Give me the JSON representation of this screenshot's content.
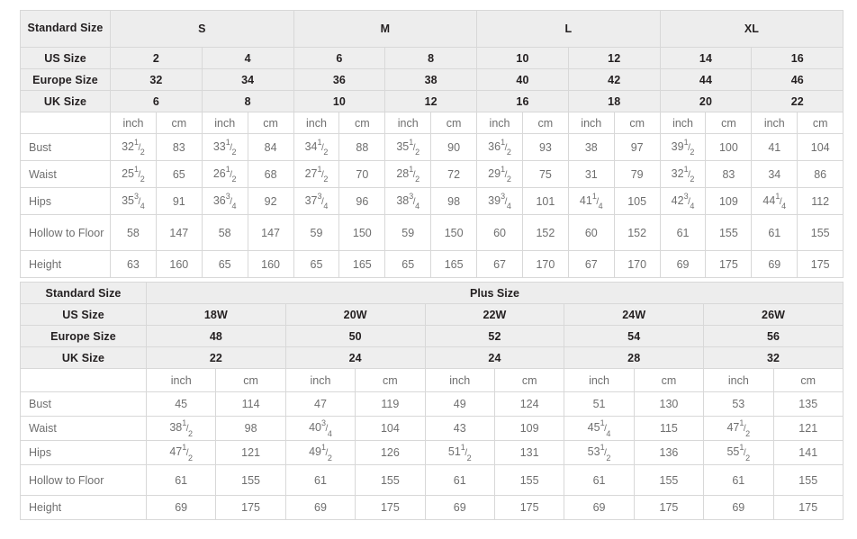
{
  "standard_table": {
    "row_labels": {
      "standard_size": "Standard Size",
      "us_size": "US Size",
      "europe_size": "Europe Size",
      "uk_size": "UK Size",
      "bust": "Bust",
      "waist": "Waist",
      "hips": "Hips",
      "hollow_to_floor": "Hollow to Floor",
      "height": "Height"
    },
    "size_groups": [
      {
        "label": "S",
        "span": 4
      },
      {
        "label": "M",
        "span": 4
      },
      {
        "label": "L",
        "span": 4
      },
      {
        "label": "XL",
        "span": 4
      }
    ],
    "us_size": [
      "2",
      "4",
      "6",
      "8",
      "10",
      "12",
      "14",
      "16"
    ],
    "europe_size": [
      "32",
      "34",
      "36",
      "38",
      "40",
      "42",
      "44",
      "46"
    ],
    "uk_size": [
      "6",
      "8",
      "10",
      "12",
      "16",
      "18",
      "20",
      "22"
    ],
    "units": [
      "inch",
      "cm",
      "inch",
      "cm",
      "inch",
      "cm",
      "inch",
      "cm",
      "inch",
      "cm",
      "inch",
      "cm",
      "inch",
      "cm",
      "inch",
      "cm"
    ],
    "measurements": [
      {
        "label": "Bust",
        "values": [
          {
            "whole": "32",
            "num": "1",
            "den": "2"
          },
          {
            "whole": "83"
          },
          {
            "whole": "33",
            "num": "1",
            "den": "2"
          },
          {
            "whole": "84"
          },
          {
            "whole": "34",
            "num": "1",
            "den": "2"
          },
          {
            "whole": "88"
          },
          {
            "whole": "35",
            "num": "1",
            "den": "2"
          },
          {
            "whole": "90"
          },
          {
            "whole": "36",
            "num": "1",
            "den": "2"
          },
          {
            "whole": "93"
          },
          {
            "whole": "38"
          },
          {
            "whole": "97"
          },
          {
            "whole": "39",
            "num": "1",
            "den": "2"
          },
          {
            "whole": "100"
          },
          {
            "whole": "41"
          },
          {
            "whole": "104"
          }
        ]
      },
      {
        "label": "Waist",
        "values": [
          {
            "whole": "25",
            "num": "1",
            "den": "2"
          },
          {
            "whole": "65"
          },
          {
            "whole": "26",
            "num": "1",
            "den": "2"
          },
          {
            "whole": "68"
          },
          {
            "whole": "27",
            "num": "1",
            "den": "2"
          },
          {
            "whole": "70"
          },
          {
            "whole": "28",
            "num": "1",
            "den": "2"
          },
          {
            "whole": "72"
          },
          {
            "whole": "29",
            "num": "1",
            "den": "2"
          },
          {
            "whole": "75"
          },
          {
            "whole": "31"
          },
          {
            "whole": "79"
          },
          {
            "whole": "32",
            "num": "1",
            "den": "2"
          },
          {
            "whole": "83"
          },
          {
            "whole": "34"
          },
          {
            "whole": "86"
          }
        ]
      },
      {
        "label": "Hips",
        "values": [
          {
            "whole": "35",
            "num": "3",
            "den": "4"
          },
          {
            "whole": "91"
          },
          {
            "whole": "36",
            "num": "3",
            "den": "4"
          },
          {
            "whole": "92"
          },
          {
            "whole": "37",
            "num": "3",
            "den": "4"
          },
          {
            "whole": "96"
          },
          {
            "whole": "38",
            "num": "3",
            "den": "4"
          },
          {
            "whole": "98"
          },
          {
            "whole": "39",
            "num": "3",
            "den": "4"
          },
          {
            "whole": "101"
          },
          {
            "whole": "41",
            "num": "1",
            "den": "4"
          },
          {
            "whole": "105"
          },
          {
            "whole": "42",
            "num": "3",
            "den": "4"
          },
          {
            "whole": "109"
          },
          {
            "whole": "44",
            "num": "1",
            "den": "4"
          },
          {
            "whole": "112"
          }
        ]
      },
      {
        "label": "Hollow to Floor",
        "values": [
          {
            "whole": "58"
          },
          {
            "whole": "147"
          },
          {
            "whole": "58"
          },
          {
            "whole": "147"
          },
          {
            "whole": "59"
          },
          {
            "whole": "150"
          },
          {
            "whole": "59"
          },
          {
            "whole": "150"
          },
          {
            "whole": "60"
          },
          {
            "whole": "152"
          },
          {
            "whole": "60"
          },
          {
            "whole": "152"
          },
          {
            "whole": "61"
          },
          {
            "whole": "155"
          },
          {
            "whole": "61"
          },
          {
            "whole": "155"
          }
        ]
      },
      {
        "label": "Height",
        "values": [
          {
            "whole": "63"
          },
          {
            "whole": "160"
          },
          {
            "whole": "65"
          },
          {
            "whole": "160"
          },
          {
            "whole": "65"
          },
          {
            "whole": "165"
          },
          {
            "whole": "65"
          },
          {
            "whole": "165"
          },
          {
            "whole": "67"
          },
          {
            "whole": "170"
          },
          {
            "whole": "67"
          },
          {
            "whole": "170"
          },
          {
            "whole": "69"
          },
          {
            "whole": "175"
          },
          {
            "whole": "69"
          },
          {
            "whole": "175"
          }
        ]
      }
    ]
  },
  "plus_table": {
    "row_labels": {
      "standard_size": "Standard Size",
      "us_size": "US Size",
      "europe_size": "Europe Size",
      "uk_size": "UK Size"
    },
    "group_label": "Plus Size",
    "us_size": [
      "18W",
      "20W",
      "22W",
      "24W",
      "26W"
    ],
    "europe_size": [
      "48",
      "50",
      "52",
      "54",
      "56"
    ],
    "uk_size": [
      "22",
      "24",
      "24",
      "28",
      "32"
    ],
    "units": [
      "inch",
      "cm",
      "inch",
      "cm",
      "inch",
      "cm",
      "inch",
      "cm",
      "inch",
      "cm"
    ],
    "measurements": [
      {
        "label": "Bust",
        "values": [
          {
            "whole": "45"
          },
          {
            "whole": "114"
          },
          {
            "whole": "47"
          },
          {
            "whole": "119"
          },
          {
            "whole": "49"
          },
          {
            "whole": "124"
          },
          {
            "whole": "51"
          },
          {
            "whole": "130"
          },
          {
            "whole": "53"
          },
          {
            "whole": "135"
          }
        ]
      },
      {
        "label": "Waist",
        "values": [
          {
            "whole": "38",
            "num": "1",
            "den": "2"
          },
          {
            "whole": "98"
          },
          {
            "whole": "40",
            "num": "3",
            "den": "4"
          },
          {
            "whole": "104"
          },
          {
            "whole": "43"
          },
          {
            "whole": "109"
          },
          {
            "whole": "45",
            "num": "1",
            "den": "4"
          },
          {
            "whole": "115"
          },
          {
            "whole": "47",
            "num": "1",
            "den": "2"
          },
          {
            "whole": "121"
          }
        ]
      },
      {
        "label": "Hips",
        "values": [
          {
            "whole": "47",
            "num": "1",
            "den": "2"
          },
          {
            "whole": "121"
          },
          {
            "whole": "49",
            "num": "1",
            "den": "2"
          },
          {
            "whole": "126"
          },
          {
            "whole": "51",
            "num": "1",
            "den": "2"
          },
          {
            "whole": "131"
          },
          {
            "whole": "53",
            "num": "1",
            "den": "2"
          },
          {
            "whole": "136"
          },
          {
            "whole": "55",
            "num": "1",
            "den": "2"
          },
          {
            "whole": "141"
          }
        ]
      },
      {
        "label": "Hollow to Floor",
        "values": [
          {
            "whole": "61"
          },
          {
            "whole": "155"
          },
          {
            "whole": "61"
          },
          {
            "whole": "155"
          },
          {
            "whole": "61"
          },
          {
            "whole": "155"
          },
          {
            "whole": "61"
          },
          {
            "whole": "155"
          },
          {
            "whole": "61"
          },
          {
            "whole": "155"
          }
        ]
      },
      {
        "label": "Height",
        "values": [
          {
            "whole": "69"
          },
          {
            "whole": "175"
          },
          {
            "whole": "69"
          },
          {
            "whole": "175"
          },
          {
            "whole": "69"
          },
          {
            "whole": "175"
          },
          {
            "whole": "69"
          },
          {
            "whole": "175"
          },
          {
            "whole": "69"
          },
          {
            "whole": "175"
          }
        ]
      }
    ]
  },
  "colors": {
    "header_bg": "#eeeeee",
    "body_text": "#6f6f6f",
    "header_text": "#231f20",
    "border": "#d8d8d8",
    "page_bg": "#ffffff"
  }
}
